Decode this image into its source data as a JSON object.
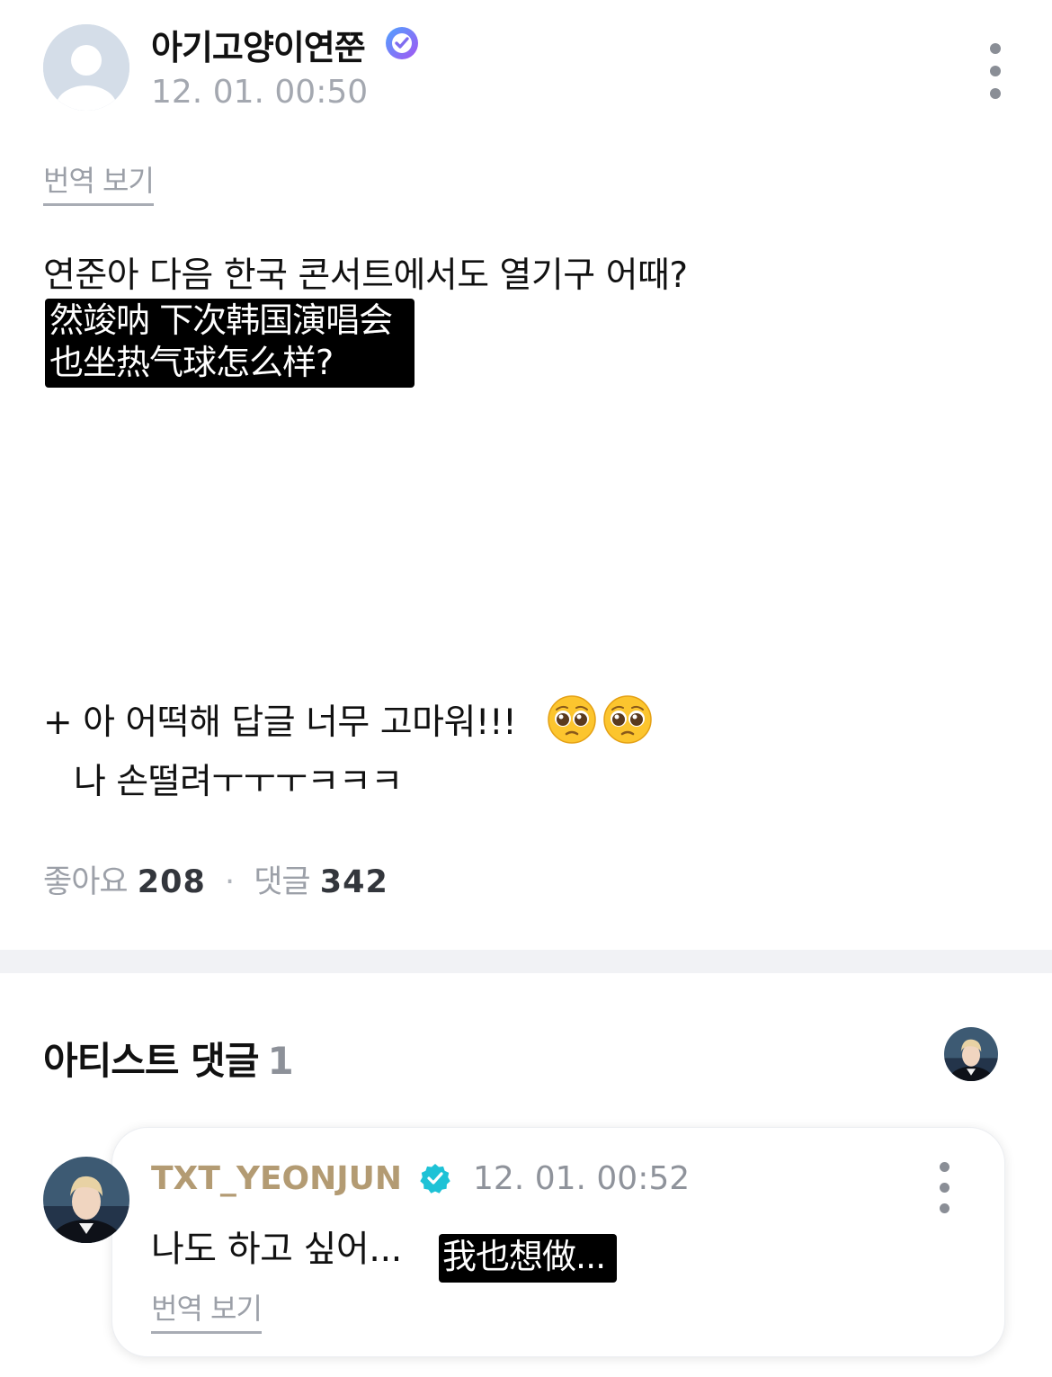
{
  "post": {
    "author": "아기고양이연쭌",
    "timestamp": "12. 01. 00:50",
    "translate_label": "번역 보기",
    "text": "연준아 다음 한국 콘서트에서도 열기구 어때?",
    "caption_line1": "然竣呐 下次韩国演唱会",
    "caption_line2": "也坐热气球怎么样?",
    "addendum_line1": "+ 아 어떡해 답글 너무 고마워!!!",
    "addendum_line2": "나 손떨려ㅜㅜㅜㅋㅋㅋ",
    "emojis": [
      "pleading-face",
      "pleading-face"
    ],
    "likes_label": "좋아요",
    "likes_count": "208",
    "separator": "·",
    "comments_label": "댓글",
    "comments_count": "342"
  },
  "artist_section": {
    "title": "아티스트 댓글",
    "count": "1"
  },
  "artist_comment": {
    "author": "TXT_YEONJUN",
    "timestamp": "12. 01. 00:52",
    "text": "나도 하고 싶어...",
    "caption": "我也想做...",
    "translate_label": "번역 보기"
  },
  "colors": {
    "author_gold": "#b39b73",
    "verified_purple": "#7f6cf0",
    "verified_teal": "#1ec2d6",
    "muted_gray": "#9ca0a8",
    "divider": "#f1f2f5"
  }
}
